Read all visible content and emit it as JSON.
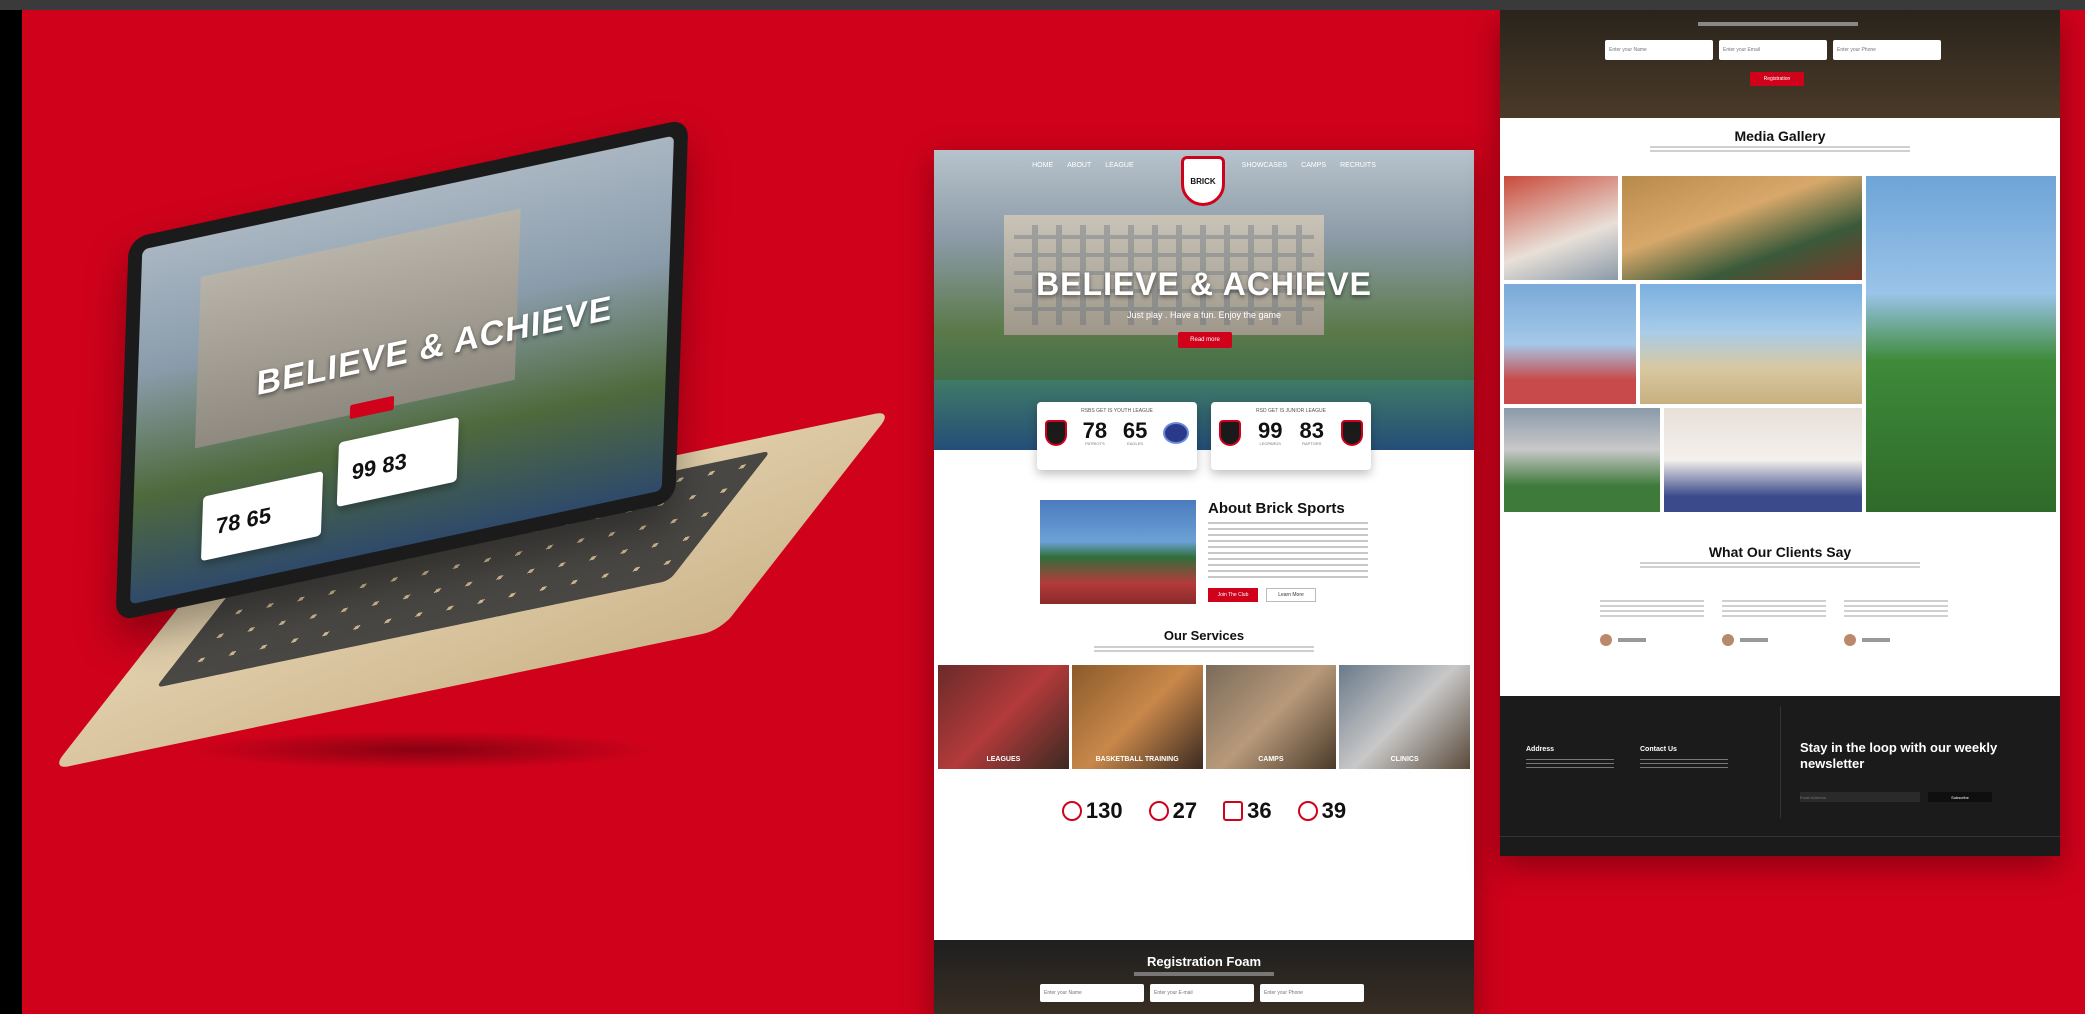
{
  "colors": {
    "brand_red": "#d0021b",
    "dark": "#1b1b1b"
  },
  "laptop": {
    "headline": "BELIEVE & ACHIEVE",
    "stats": [
      "78",
      "65",
      "99",
      "83"
    ]
  },
  "mid": {
    "nav": [
      "HOME",
      "ABOUT",
      "LEAGUE",
      "SHOWCASES",
      "CAMPS",
      "RECRUITS"
    ],
    "logo": "BRICK",
    "hero_title": "BELIEVE & ACHIEVE",
    "hero_tagline": "Just play . Have a fun. Enjoy the game",
    "hero_cta": "Read more",
    "stat_cards": [
      {
        "caption": "RSBS GET IS YOUTH LEAGUE",
        "left": "78",
        "left_sub": "PATRIOTS",
        "right": "65",
        "right_sub": "EAGLES"
      },
      {
        "caption": "RSD GET IS JUNIOR LEAGUE",
        "left": "99",
        "left_sub": "LEOPARDS",
        "right": "83",
        "right_sub": "RAPTORS"
      }
    ],
    "about_title": "About Brick Sports",
    "about_btn_primary": "Join The Club",
    "about_btn_secondary": "Learn More",
    "services_title": "Our Services",
    "services": [
      "LEAGUES",
      "BASKETBALL TRAINING",
      "CAMPS",
      "CLINICS"
    ],
    "counters": [
      "130",
      "27",
      "36",
      "39"
    ],
    "registration_title": "Registration Foam",
    "fields": [
      "Enter your Name",
      "Enter your E-mail",
      "Enter your Phone"
    ]
  },
  "right": {
    "fields": [
      "Enter your Name",
      "Enter your Email",
      "Enter your Phone"
    ],
    "register_btn": "Registration",
    "gallery_title": "Media Gallery",
    "testimonials_title": "What Our Clients Say",
    "footer": {
      "address_title": "Address",
      "contact_title": "Contact Us",
      "newsletter": "Stay in the loop with our weekly newsletter",
      "newsletter_placeholder": "Email Address",
      "newsletter_btn": "Subscribe"
    }
  }
}
